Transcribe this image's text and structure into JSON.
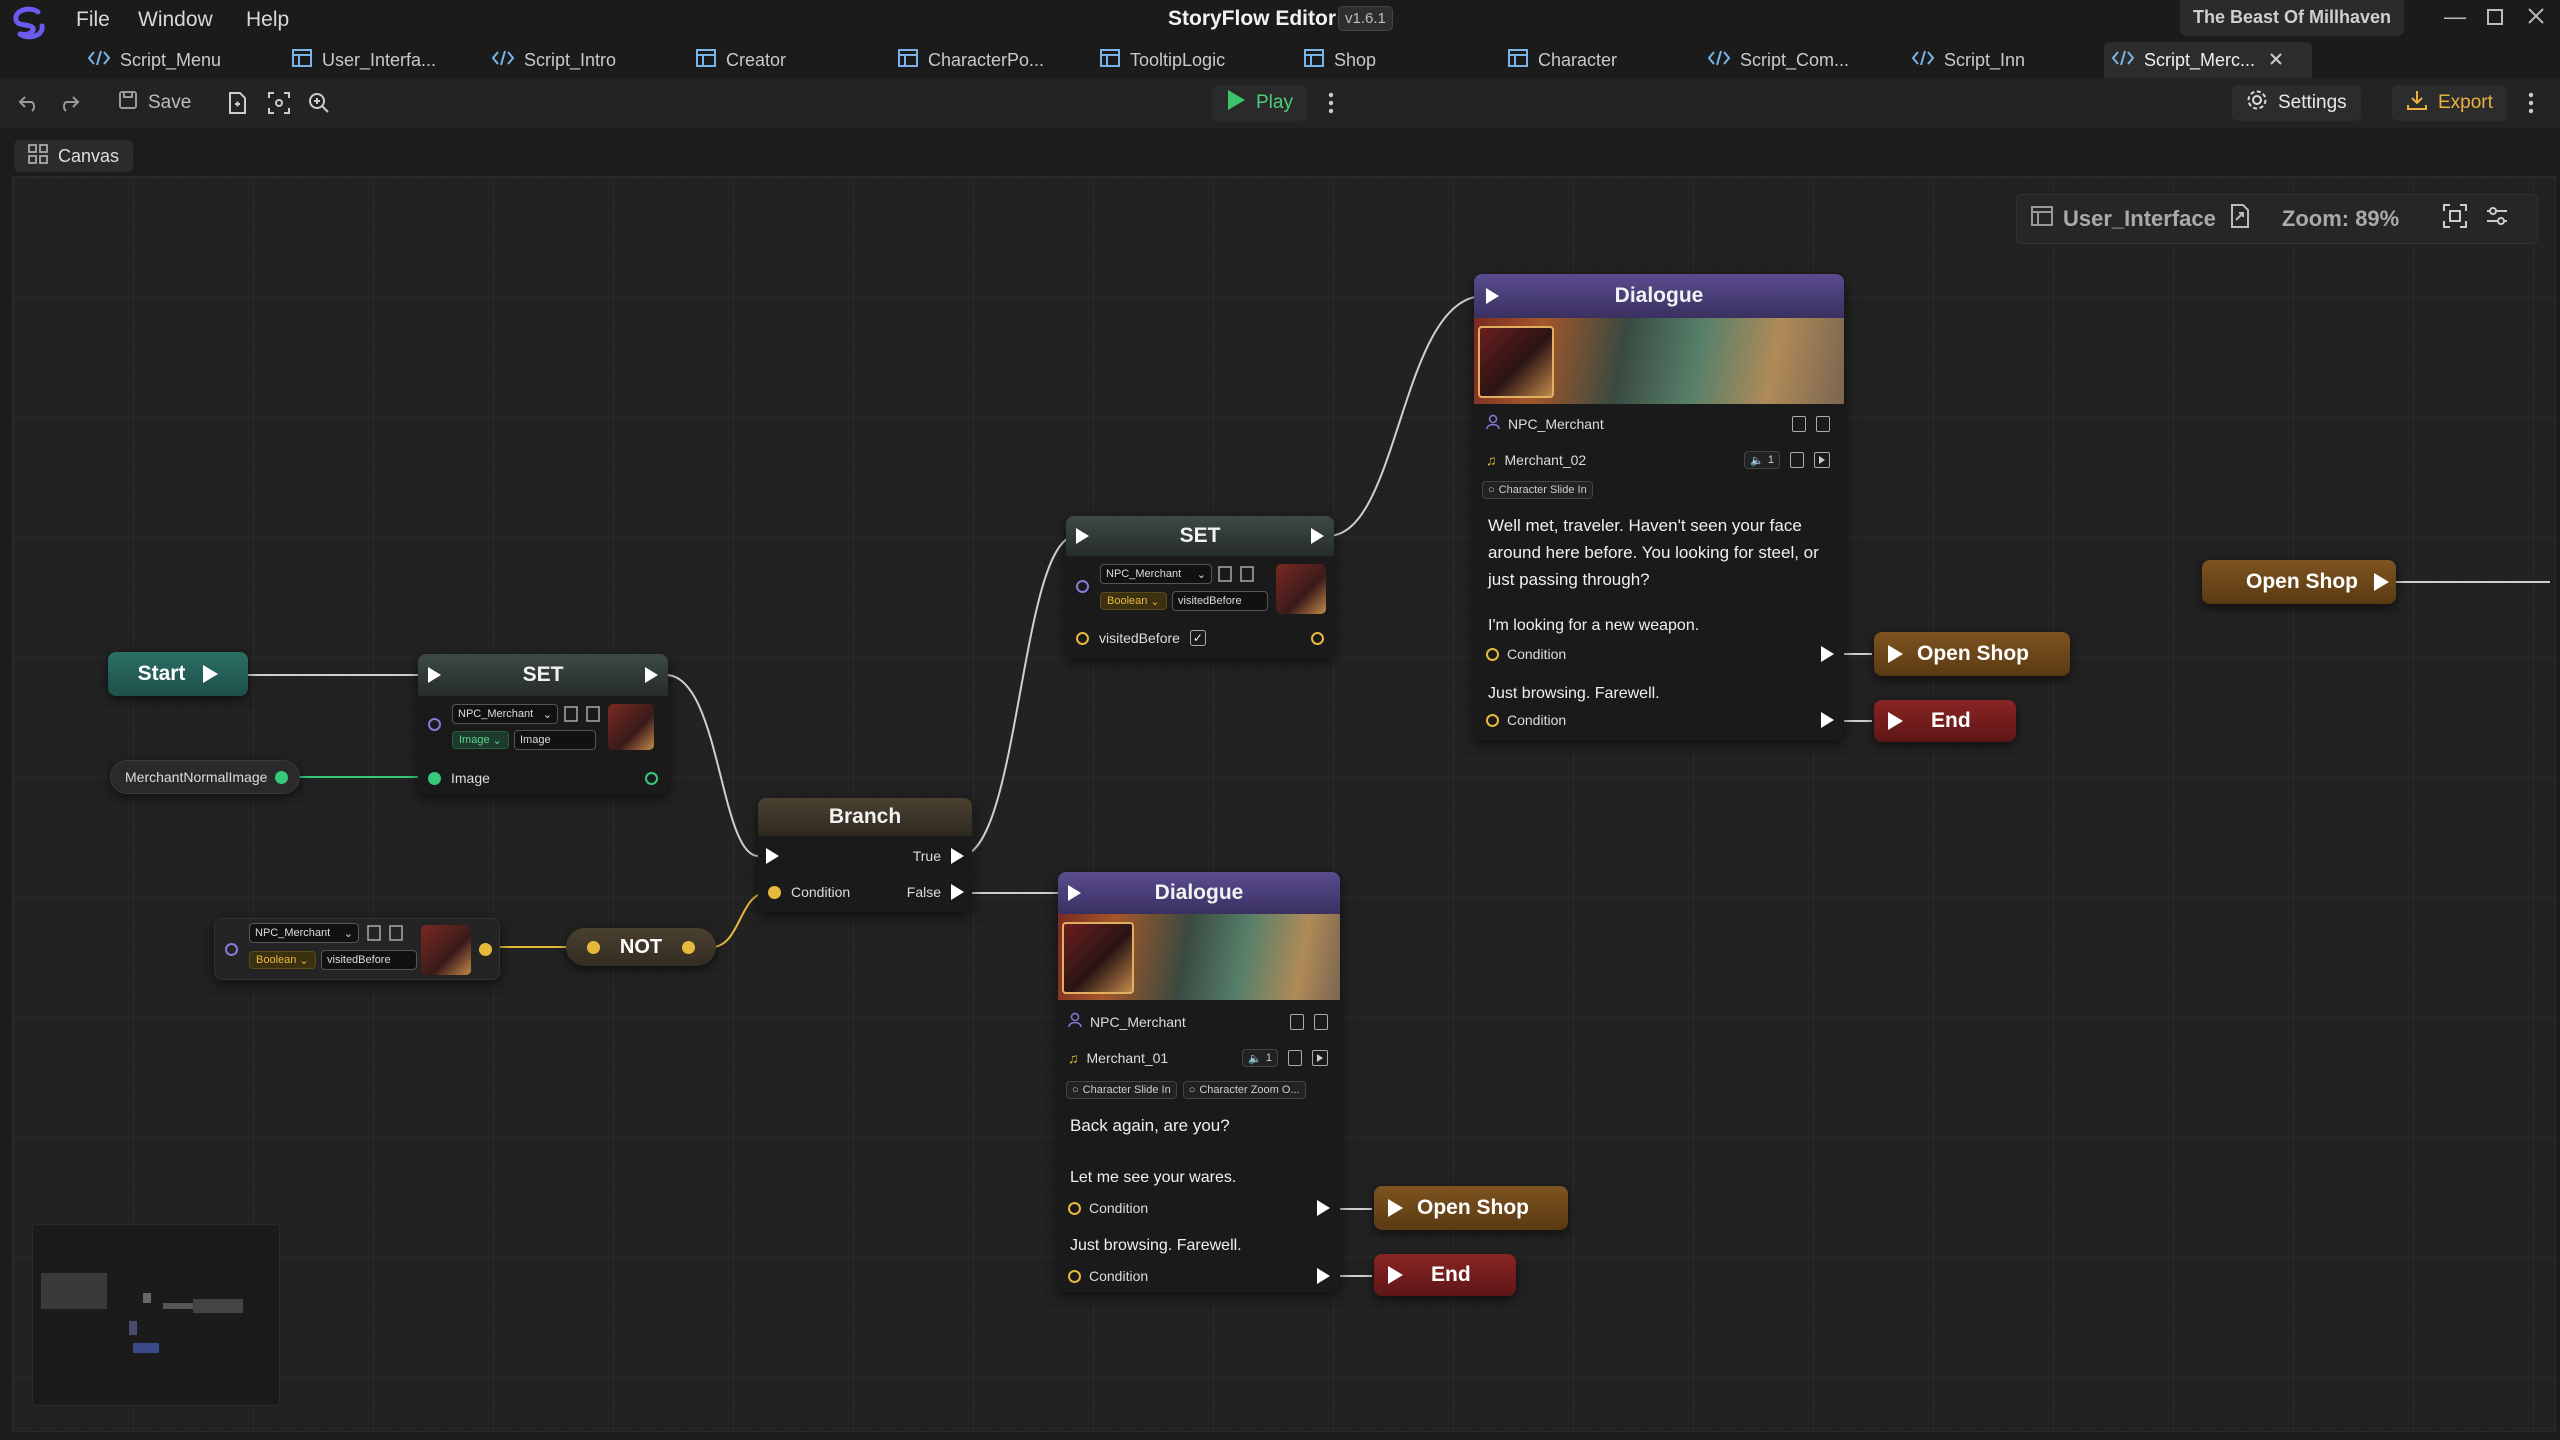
{
  "app": {
    "title": "StoryFlow Editor",
    "version": "v1.6.1",
    "project": "The Beast Of Millhaven"
  },
  "menu": [
    "File",
    "Window",
    "Help"
  ],
  "tabs": [
    {
      "label": "Script_Menu",
      "icon": "code-icon"
    },
    {
      "label": "User_Interfa...",
      "icon": "layout-icon"
    },
    {
      "label": "Script_Intro",
      "icon": "code-icon"
    },
    {
      "label": "Creator",
      "icon": "layout-icon"
    },
    {
      "label": "CharacterPo...",
      "icon": "layout-icon"
    },
    {
      "label": "TooltipLogic",
      "icon": "layout-icon"
    },
    {
      "label": "Shop",
      "icon": "layout-icon"
    },
    {
      "label": "Character",
      "icon": "layout-icon"
    },
    {
      "label": "Script_Com...",
      "icon": "code-icon"
    },
    {
      "label": "Script_Inn",
      "icon": "code-icon"
    },
    {
      "label": "Script_Merc...",
      "icon": "code-icon",
      "active": true
    }
  ],
  "toolbar": {
    "save": "Save",
    "play": "Play",
    "settings": "Settings",
    "export": "Export"
  },
  "canvas_tab": "Canvas",
  "info": {
    "file": "User_Interface",
    "zoom": "Zoom: 89%"
  },
  "nodes": {
    "start": "Start",
    "set1": {
      "title": "SET",
      "character": "NPC_Merchant",
      "type": "Image",
      "field": "Image",
      "input": "Image"
    },
    "var_image": "MerchantNormalImage",
    "getter": {
      "character": "NPC_Merchant",
      "type": "Boolean",
      "field": "visitedBefore"
    },
    "not": "NOT",
    "branch": {
      "title": "Branch",
      "condition": "Condition",
      "true": "True",
      "false": "False"
    },
    "set2": {
      "title": "SET",
      "character": "NPC_Merchant",
      "type": "Boolean",
      "field": "visitedBefore",
      "input": "visitedBefore"
    },
    "dialogue1": {
      "title": "Dialogue",
      "character": "NPC_Merchant",
      "audio": "Merchant_02",
      "audio_count": "1",
      "tags": [
        "Character Slide In"
      ],
      "text": "Well met, traveler. Haven't seen your face around here before. You looking for steel, or just passing through?",
      "options": [
        {
          "text": "I'm looking for a new weapon.",
          "condition": "Condition"
        },
        {
          "text": "Just browsing. Farewell.",
          "condition": "Condition"
        }
      ]
    },
    "dialogue2": {
      "title": "Dialogue",
      "character": "NPC_Merchant",
      "audio": "Merchant_01",
      "audio_count": "1",
      "tags": [
        "Character Slide In",
        "Character Zoom O..."
      ],
      "text": "Back again, are you?",
      "options": [
        {
          "text": "Let me see your wares.",
          "condition": "Condition"
        },
        {
          "text": "Just browsing. Farewell.",
          "condition": "Condition"
        }
      ]
    },
    "open_shop_1": "Open Shop",
    "end_1": "End",
    "open_shop_2": "Open Shop",
    "end_2": "End",
    "open_shop_3": "Open Shop"
  },
  "colors": {
    "start": "#1f5a52",
    "set": "#2f3a36",
    "branch": "#3a342a",
    "dialogue": "#4b3f78",
    "open_shop": "#6e4718",
    "end": "#7a1f1f",
    "wire_exec": "#cfcfcf",
    "wire_bool": "#e7b93b",
    "wire_image": "#38c87a"
  }
}
